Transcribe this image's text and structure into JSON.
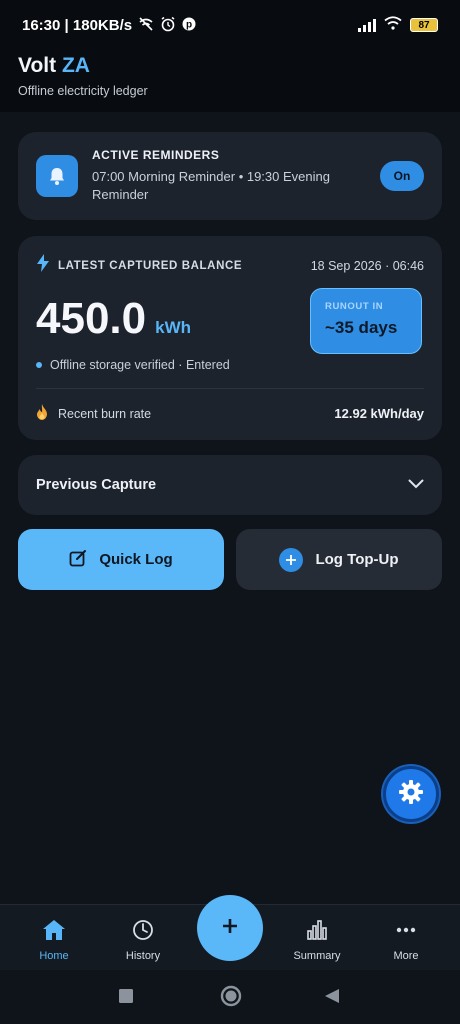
{
  "statusbar": {
    "time_speed": "16:30 | 180KB/s",
    "battery": "87",
    "icons": [
      "wifi-off-icon",
      "alarm-icon",
      "pinterest-icon",
      "signal-icon",
      "wifi-icon",
      "battery-icon"
    ]
  },
  "header": {
    "title_main": "Volt",
    "title_accent": "ZA",
    "subtitle": "Offline electricity ledger"
  },
  "reminders": {
    "title": "ACTIVE REMINDERS",
    "body": "07:00 Morning Reminder • 19:30 Evening Reminder",
    "toggle_label": "On"
  },
  "balance": {
    "label": "LATEST CAPTURED BALANCE",
    "date": "18 Sep 2026 · 06:46",
    "value": "450.0",
    "unit": "kWh",
    "verified": "Offline storage verified · Entered",
    "runout_label": "RUNOUT IN",
    "runout_value": "~35 days",
    "burn_label": "Recent burn rate",
    "burn_value": "12.92 kWh/day"
  },
  "previous": {
    "label": "Previous Capture"
  },
  "actions": {
    "quick_log": "Quick Log",
    "top_up": "Log Top-Up"
  },
  "nav": {
    "home": "Home",
    "history": "History",
    "summary": "Summary",
    "more": "More"
  },
  "colors": {
    "accent": "#58b6f8",
    "primary_blue": "#2f8de4",
    "background": "#0f141b",
    "card": "#1d232c"
  }
}
